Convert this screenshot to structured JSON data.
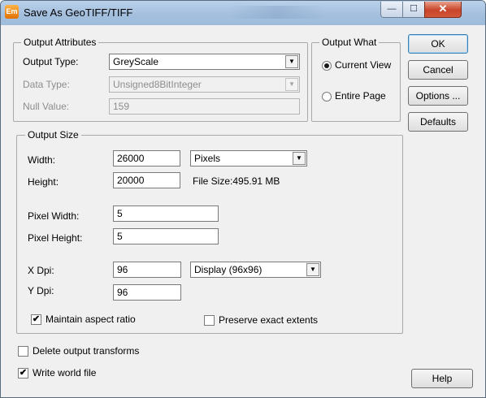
{
  "window": {
    "title": "Save As GeoTIFF/TIFF",
    "app_icon_text": "Em",
    "minimize_symbol": "—",
    "maximize_symbol": "☐",
    "close_symbol": "✕"
  },
  "output_attributes": {
    "group_label": "Output Attributes",
    "output_type_label": "Output Type:",
    "output_type_value": "GreyScale",
    "data_type_label": "Data Type:",
    "data_type_value": "Unsigned8BitInteger",
    "null_value_label": "Null Value:",
    "null_value_value": "159"
  },
  "output_what": {
    "group_label": "Output What",
    "current_view_label": "Current View",
    "entire_page_label": "Entire Page",
    "selected": "current_view"
  },
  "buttons": {
    "ok": "OK",
    "cancel": "Cancel",
    "options": "Options ...",
    "defaults": "Defaults",
    "help": "Help"
  },
  "output_size": {
    "group_label": "Output Size",
    "width_label": "Width:",
    "width_value": "26000",
    "units_value": "Pixels",
    "height_label": "Height:",
    "height_value": "20000",
    "file_size_text": "File Size:495.91 MB",
    "pixel_width_label": "Pixel Width:",
    "pixel_width_value": "5",
    "pixel_height_label": "Pixel Height:",
    "pixel_height_value": "5",
    "x_dpi_label": "X Dpi:",
    "x_dpi_value": "96",
    "dpi_preset_value": "Display (96x96)",
    "y_dpi_label": "Y Dpi:",
    "y_dpi_value": "96",
    "maintain_aspect_label": "Maintain aspect ratio",
    "maintain_aspect_checked": true,
    "preserve_extents_label": "Preserve exact extents",
    "preserve_extents_checked": false
  },
  "options": {
    "delete_transforms_label": "Delete output transforms",
    "delete_transforms_checked": false,
    "write_world_file_label": "Write world file",
    "write_world_file_checked": true
  },
  "icons": {
    "dropdown_arrow": "▼",
    "check_mark": "✔"
  }
}
